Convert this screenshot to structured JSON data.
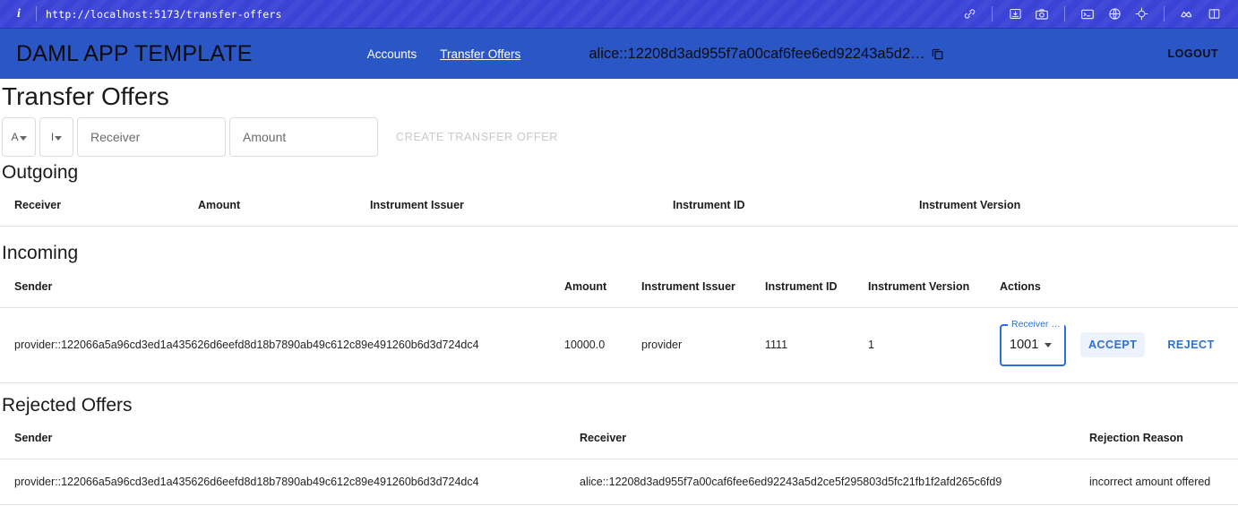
{
  "browser_bar": {
    "info_icon": "info-icon",
    "url": "http://localhost:5173/transfer-offers",
    "icons": [
      {
        "name": "link-icon"
      },
      {
        "name": "save-image-icon"
      },
      {
        "name": "camera-icon"
      },
      {
        "name": "console-icon"
      },
      {
        "name": "globe-icon"
      },
      {
        "name": "target-icon"
      },
      {
        "name": "connection-icon"
      },
      {
        "name": "split-panel-icon"
      }
    ]
  },
  "appbar": {
    "brand": "DAML APP TEMPLATE",
    "nav": [
      {
        "label": "Accounts",
        "active": false
      },
      {
        "label": "Transfer Offers",
        "active": true
      }
    ],
    "party_id": "alice::12208d3ad955f7a00caf6fee6ed92243a5d2…",
    "copy_icon": "copy-icon",
    "logout_label": "LOGOUT",
    "bar_color": "#2a56c6"
  },
  "page": {
    "title": "Transfer Offers"
  },
  "create_form": {
    "instrument_select": {
      "value": "A",
      "label": "instrument-select"
    },
    "issuer_select": {
      "value": "I",
      "label": "issuer-select"
    },
    "receiver_placeholder": "Receiver",
    "receiver_value": "",
    "amount_placeholder": "Amount",
    "amount_value": "",
    "submit_label": "CREATE TRANSFER OFFER",
    "submit_disabled": true
  },
  "outgoing": {
    "title": "Outgoing",
    "columns": [
      "Receiver",
      "Amount",
      "Instrument Issuer",
      "Instrument ID",
      "Instrument Version"
    ],
    "rows": []
  },
  "incoming": {
    "title": "Incoming",
    "columns": [
      "Sender",
      "Amount",
      "Instrument Issuer",
      "Instrument ID",
      "Instrument Version",
      "Actions"
    ],
    "row": {
      "sender": "provider::122066a5a96cd3ed1a435626d6eefd8d18b7890ab49c612c89e491260b6d3d724dc4",
      "amount": "10000.0",
      "instrument_issuer": "provider",
      "instrument_id": "1111",
      "instrument_version": "1",
      "receiver_select_label": "Receiver …",
      "receiver_select_value": "1001",
      "accept_label": "ACCEPT",
      "reject_label": "REJECT"
    }
  },
  "rejected": {
    "title": "Rejected Offers",
    "columns": [
      "Sender",
      "Receiver",
      "Rejection Reason"
    ],
    "row": {
      "sender": "provider::122066a5a96cd3ed1a435626d6eefd8d18b7890ab49c612c89e491260b6d3d724dc4",
      "receiver": "alice::12208d3ad955f7a00caf6fee6ed92243a5d2ce5f295803d5fc21fb1f2afd265c6fd9",
      "reason": "incorrect amount offered"
    }
  },
  "colors": {
    "browser_bar": "#3b43d6",
    "app_bar": "#2a56c6",
    "accent": "#2f6fd0"
  }
}
